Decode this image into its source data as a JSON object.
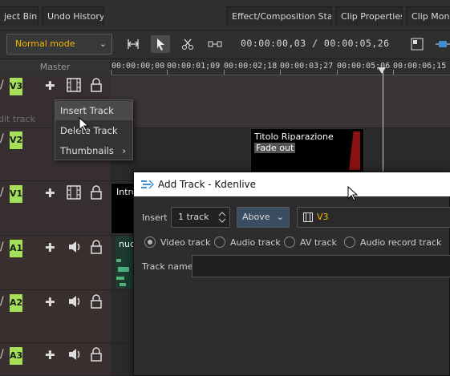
{
  "tabs": [
    {
      "label": "ject Bin"
    },
    {
      "label": "Undo History"
    },
    {
      "label": "Effect/Composition Stack"
    },
    {
      "label": "Clip Properties"
    },
    {
      "label": "Clip Monito"
    }
  ],
  "toolbar": {
    "mode_label": "Normal mode",
    "timecode": "00:00:00,03 / 00:00:05,26"
  },
  "ruler": {
    "master_label": "Master",
    "labels": [
      "00:00:00;00",
      "00:00:01;09",
      "00:00:02;18",
      "00:00:03;27",
      "00:00:05;06",
      "00:00:06;15"
    ]
  },
  "tracks": [
    {
      "name": "V3",
      "type": "video"
    },
    {
      "name": "V2",
      "type": "video"
    },
    {
      "name": "V1",
      "type": "video"
    },
    {
      "name": "A1",
      "type": "audio"
    },
    {
      "name": "A2",
      "type": "audio"
    },
    {
      "name": "A3",
      "type": "audio"
    }
  ],
  "edit_track_label": "dit track",
  "clips": {
    "title_clip_line1": "Titolo Riparazione",
    "title_clip_line2": "Fade out",
    "intro_clip": "Intro",
    "audio_clip": "nuc"
  },
  "context_menu": {
    "insert": "Insert Track",
    "delete": "Delete Track",
    "thumbnails": "Thumbnails"
  },
  "dialog": {
    "title": "Add Track - Kdenlive",
    "insert_label": "Insert",
    "count_value": "1 track",
    "position_value": "Above",
    "target_track": "V3",
    "radio_video": "Video track",
    "radio_audio": "Audio track",
    "radio_av": "AV track",
    "radio_audio_record": "Audio record track",
    "track_name_label": "Track name",
    "track_name_value": ""
  },
  "colors": {
    "accent_yellow": "#f5b800",
    "track_label_green": "#a5e05a",
    "selected_combo": "#3b4d60"
  }
}
